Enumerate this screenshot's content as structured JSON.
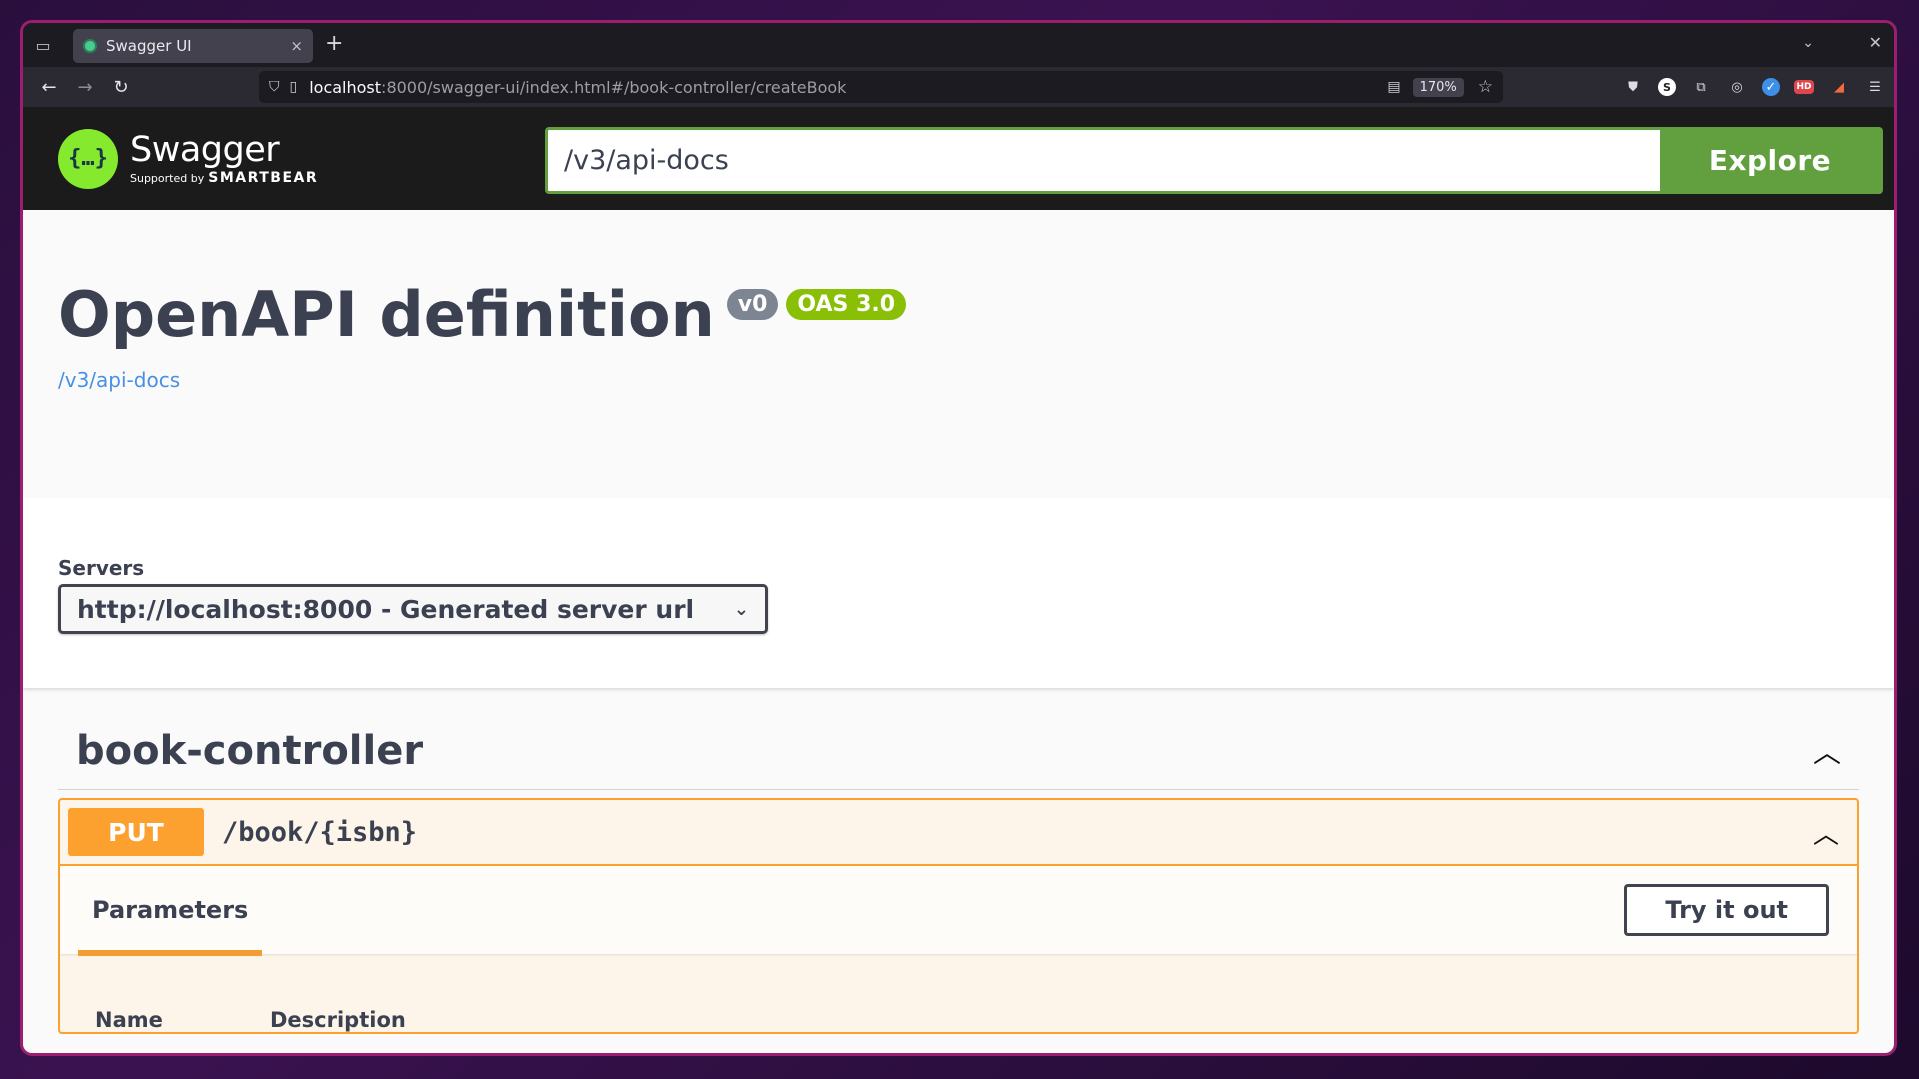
{
  "browser": {
    "tab_title": "Swagger UI",
    "tab_close": "×",
    "new_tab": "+",
    "url_host": "localhost",
    "url_rest": ":8000/swagger-ui/index.html#/book-controller/createBook",
    "zoom": "170%"
  },
  "header": {
    "logo_name": "Swagger",
    "logo_supported": "Supported by",
    "logo_brand": "SMARTBEAR",
    "explore_value": "/v3/api-docs",
    "explore_label": "Explore"
  },
  "info": {
    "title": "OpenAPI definition",
    "version": "v0",
    "oas": "OAS 3.0",
    "link": "/v3/api-docs"
  },
  "servers": {
    "label": "Servers",
    "selected": "http://localhost:8000 - Generated server url"
  },
  "tag": {
    "name": "book-controller"
  },
  "operation": {
    "method": "PUT",
    "path": "/book/{isbn}",
    "params_tab": "Parameters",
    "try_label": "Try it out",
    "col_name": "Name",
    "col_description": "Description"
  },
  "colors": {
    "put": "#fca130",
    "explore": "#62a03f",
    "oas_badge": "#89bf04",
    "version_badge": "#7d8492",
    "window_border": "#9b1f6e"
  }
}
